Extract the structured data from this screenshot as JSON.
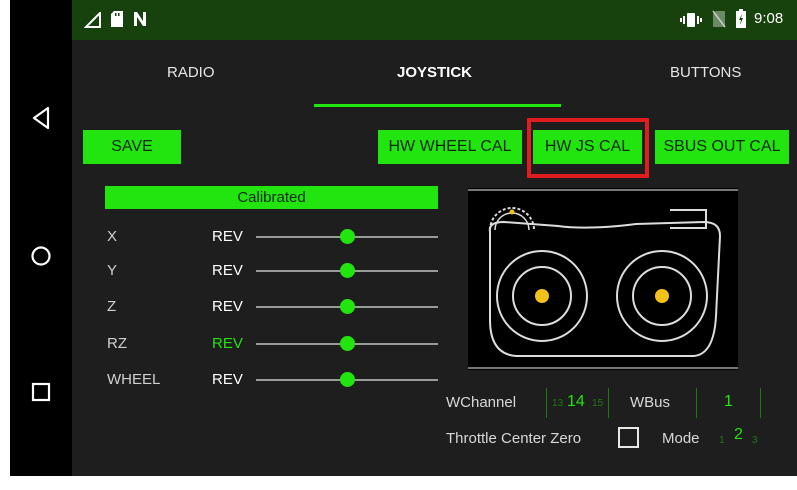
{
  "colors": {
    "accent": "#22e40e",
    "highlight_border": "#e21d1d",
    "screen_bg": "#1e1e1e",
    "status_bar": "#17410d"
  },
  "status_bar": {
    "time": "9:08",
    "icons": [
      "signal-icon",
      "sd-card-icon",
      "notification-n-icon",
      "vibrate-icon",
      "no-sim-icon",
      "battery-icon"
    ]
  },
  "nav_bar": {
    "icons": [
      "back-icon",
      "home-icon",
      "recents-icon"
    ]
  },
  "tabs": [
    {
      "label": "RADIO",
      "active": false
    },
    {
      "label": "JOYSTICK",
      "active": true
    },
    {
      "label": "BUTTONS",
      "active": false
    }
  ],
  "toolbar": {
    "save_label": "SAVE",
    "wheel_cal_label": "HW WHEEL CAL",
    "js_cal_label": "HW JS CAL",
    "sbus_cal_label": "SBUS OUT CAL"
  },
  "calibration": {
    "status": "Calibrated"
  },
  "axes": [
    {
      "label": "X",
      "rev": "REV",
      "rev_active": false,
      "level": 0.5
    },
    {
      "label": "Y",
      "rev": "REV",
      "rev_active": false,
      "level": 0.5
    },
    {
      "label": "Z",
      "rev": "REV",
      "rev_active": false,
      "level": 0.5
    },
    {
      "label": "RZ",
      "rev": "REV",
      "rev_active": true,
      "level": 0.5
    },
    {
      "label": "WHEEL",
      "rev": "REV",
      "rev_active": false,
      "level": 0.5
    }
  ],
  "settings": {
    "wchannel_label": "WChannel",
    "wchannel_value": "14",
    "wbus_label": "WBus",
    "wbus_value": "1",
    "throttle_label": "Throttle Center Zero",
    "throttle_checked": false,
    "mode_label": "Mode",
    "mode_value": "2",
    "wchannel_prev": "13",
    "wchannel_next": "15",
    "mode_prev": "1",
    "mode_next": "3"
  }
}
